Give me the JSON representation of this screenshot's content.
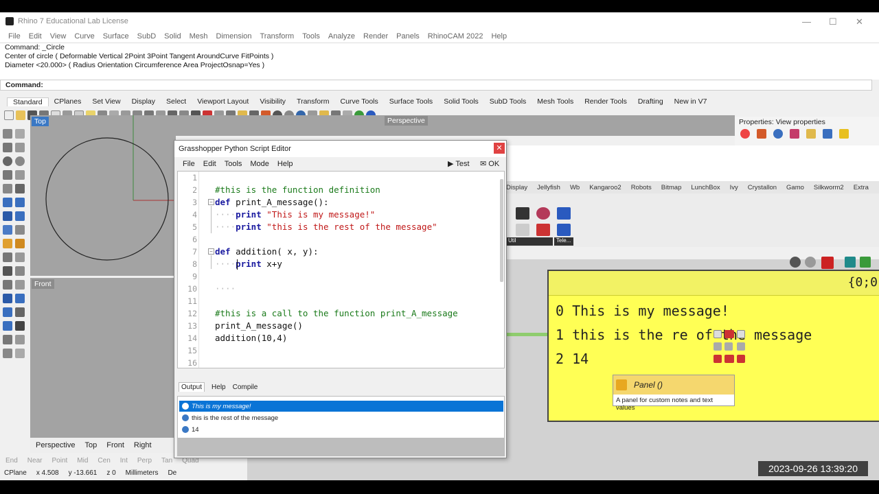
{
  "window": {
    "title": "Rhino 7 Educational Lab License",
    "controls": [
      "—",
      "☐",
      "✕"
    ]
  },
  "menu": [
    "File",
    "Edit",
    "View",
    "Curve",
    "Surface",
    "SubD",
    "Solid",
    "Mesh",
    "Dimension",
    "Transform",
    "Tools",
    "Analyze",
    "Render",
    "Panels",
    "RhinoCAM 2022",
    "Help"
  ],
  "command_history": [
    "Command: _Circle",
    "Center of circle ( Deformable  Vertical  2Point  3Point  Tangent  AroundCurve  FitPoints )",
    "Diameter <20.000> ( Radius  Orientation  Circumference  Area  ProjectOsnap=Yes )"
  ],
  "command_prompt": "Command:",
  "toolbar_tabs": [
    "Standard",
    "CPlanes",
    "Set View",
    "Display",
    "Select",
    "Viewport Layout",
    "Visibility",
    "Transform",
    "Curve Tools",
    "Surface Tools",
    "Solid Tools",
    "SubD Tools",
    "Mesh Tools",
    "Render Tools",
    "Drafting",
    "New in V7"
  ],
  "viewports": {
    "top": "Top",
    "perspective": "Perspective",
    "front": "Front"
  },
  "viewport_tabs": [
    "Perspective",
    "Top",
    "Front",
    "Right"
  ],
  "osnaps": [
    "End",
    "Near",
    "Point",
    "Mid",
    "Cen",
    "Int",
    "Perp",
    "Tan",
    "Quad"
  ],
  "status": {
    "cplane": "CPlane",
    "x": "x 4.508",
    "y": "y -13.661",
    "z": "z 0",
    "units": "Millimeters",
    "layer": "De"
  },
  "properties_title": "Properties: View properties",
  "gh_tabs": [
    "Display",
    "Jellyfish",
    "Wb",
    "Kangaroo2",
    "Robots",
    "Bitmap",
    "LunchBox",
    "Ivy",
    "Crystallon",
    "Gamo",
    "Silkworm2",
    "Extra"
  ],
  "gh_ribbon_groups": [
    "Util",
    "Tele..."
  ],
  "editor": {
    "title": "Grasshopper Python Script Editor",
    "close": "✕",
    "menu": [
      "File",
      "Edit",
      "Tools",
      "Mode",
      "Help"
    ],
    "test_label": "Test",
    "ok_label": "OK",
    "line_numbers": [
      "1",
      "2",
      "3",
      "4",
      "5",
      "6",
      "7",
      "8",
      "9",
      "10",
      "11",
      "12",
      "13",
      "14",
      "15",
      "16"
    ],
    "code": {
      "l2": "#this is the function definition",
      "l3_kw": "def",
      "l3": " print_A_message():",
      "l4_dots": "····",
      "l4_kw": "print",
      "l4_str": " \"This is my message!\"",
      "l5_dots": "····",
      "l5_kw": "print",
      "l5_str": " \"this is the rest of the message\"",
      "l7_kw": "def",
      "l7": " addition( x, y):",
      "l8_dots": "····",
      "l8_kw": "print",
      "l8": " x+y",
      "l10": "····",
      "l12": "#this is a call to the function print_A_message",
      "l13": "print_A_message()",
      "l14": "addition(10,4)"
    },
    "output_tabs": [
      "Output",
      "Help",
      "Compile"
    ],
    "output": [
      "This is my message!",
      "this is the rest of the message",
      "14"
    ]
  },
  "panel": {
    "header": "{0;0",
    "rows": [
      {
        "index": "0",
        "text": "This is my message!"
      },
      {
        "index": "1",
        "text": "this is the re  of the message"
      },
      {
        "index": "2",
        "text": "14"
      }
    ]
  },
  "tooltip": {
    "title": "Panel ()",
    "description": "A panel for custom notes and text values"
  },
  "timestamp": "2023-09-26  13:39:20",
  "colors": {
    "panel_yellow": "#ffff55",
    "selection_blue": "#0a74d6",
    "code_comment": "#1a7a1a",
    "code_keyword": "#1a1aa0",
    "code_string": "#c01818"
  }
}
